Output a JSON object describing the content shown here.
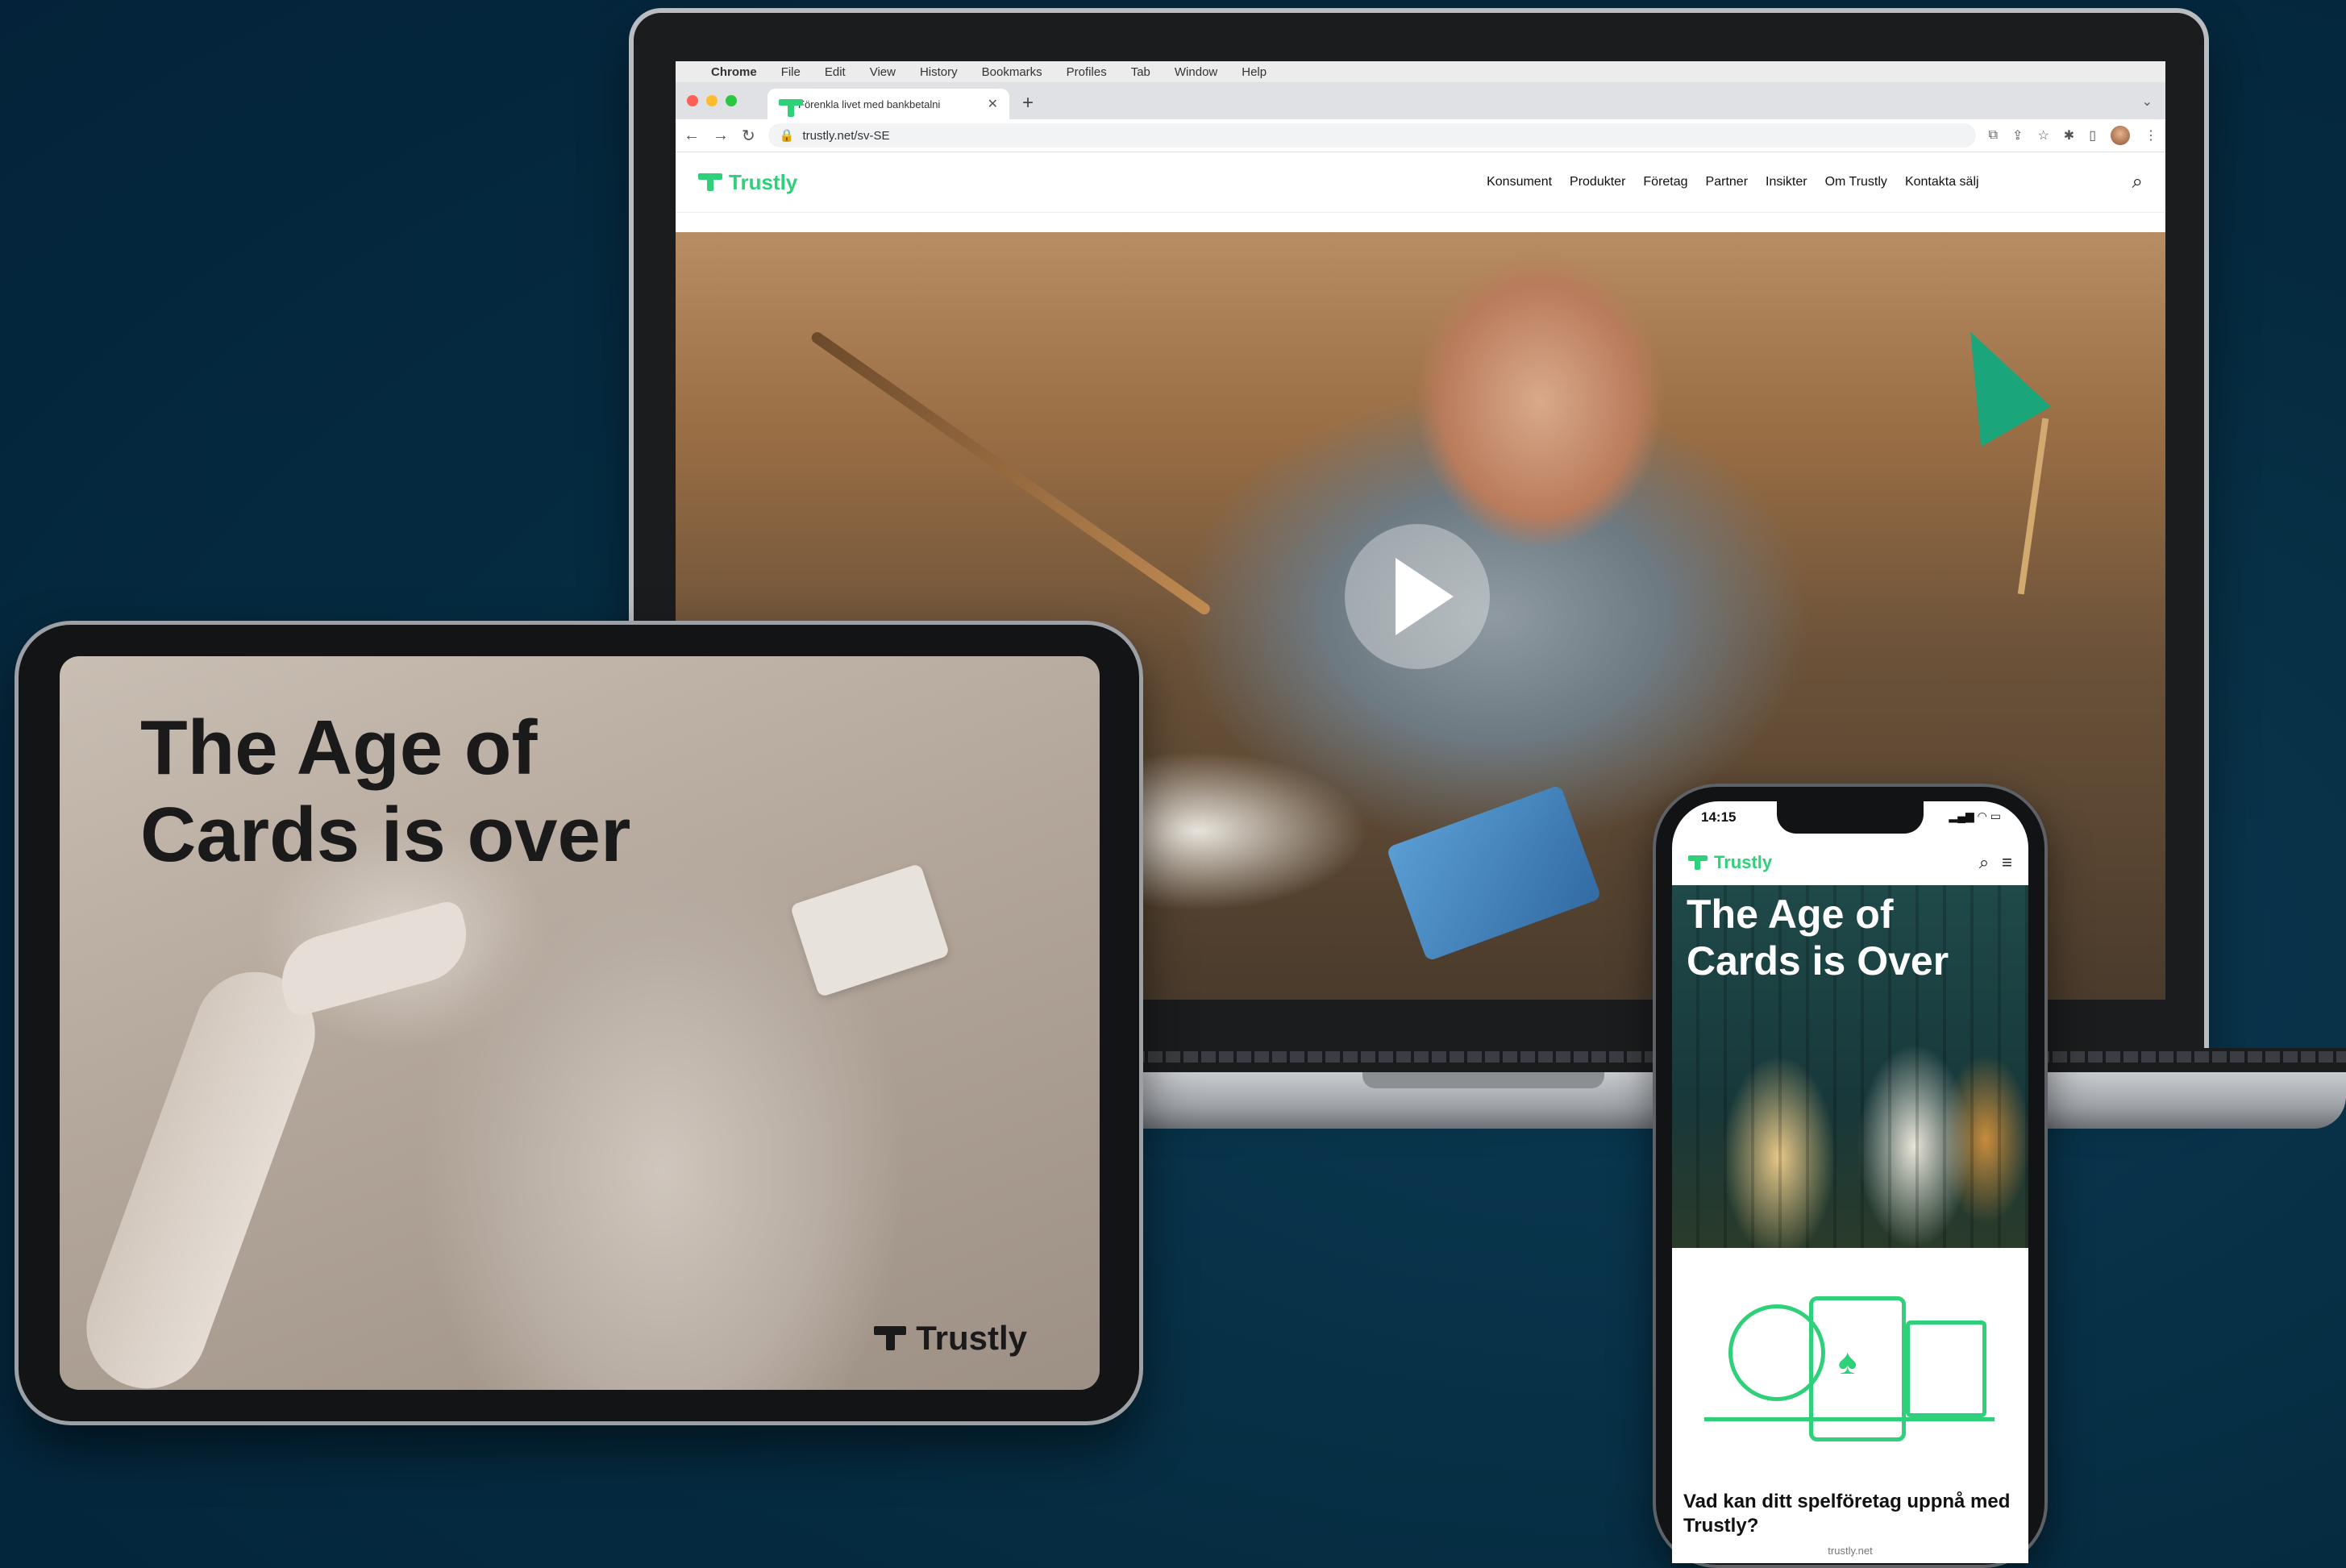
{
  "colors": {
    "background": "#052b40",
    "brand_green": "#2fd07a"
  },
  "menubar": {
    "app": "Chrome",
    "items": [
      "File",
      "Edit",
      "View",
      "History",
      "Bookmarks",
      "Profiles",
      "Tab",
      "Window",
      "Help"
    ]
  },
  "browser": {
    "tab_title": "Förenkla livet med bankbetalni",
    "url": "trustly.net/sv-SE"
  },
  "site": {
    "logo": "Trustly",
    "nav": [
      "Konsument",
      "Produkter",
      "Företag",
      "Partner",
      "Insikter",
      "Om Trustly",
      "Kontakta sälj"
    ]
  },
  "tablet": {
    "heading_line1": "The Age of",
    "heading_line2": "Cards is over",
    "logo": "Trustly"
  },
  "phone": {
    "time": "14:15",
    "logo": "Trustly",
    "heading_line1": "The Age of",
    "heading_line2": "Cards is Over",
    "caption": "Vad kan ditt spelföretag uppnå med Trustly?",
    "url": "trustly.net"
  }
}
